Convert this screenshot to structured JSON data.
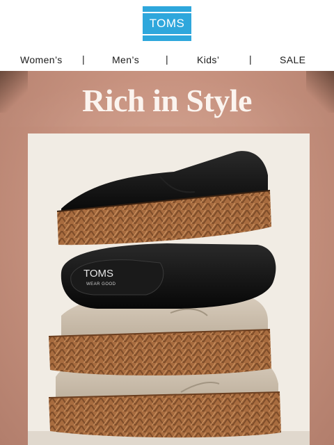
{
  "brand": {
    "logo_text": "TOMS",
    "color": "#2ea7dc"
  },
  "nav": {
    "items": [
      {
        "label": "Women’s"
      },
      {
        "label": "Men’s"
      },
      {
        "label": "Kids’"
      },
      {
        "label": "SALE"
      }
    ],
    "separator": "|"
  },
  "hero": {
    "headline": "Rich in Style",
    "background_color": "#c89380",
    "insole_brand": "TOMS",
    "insole_tagline": "WEAR GOOD"
  }
}
